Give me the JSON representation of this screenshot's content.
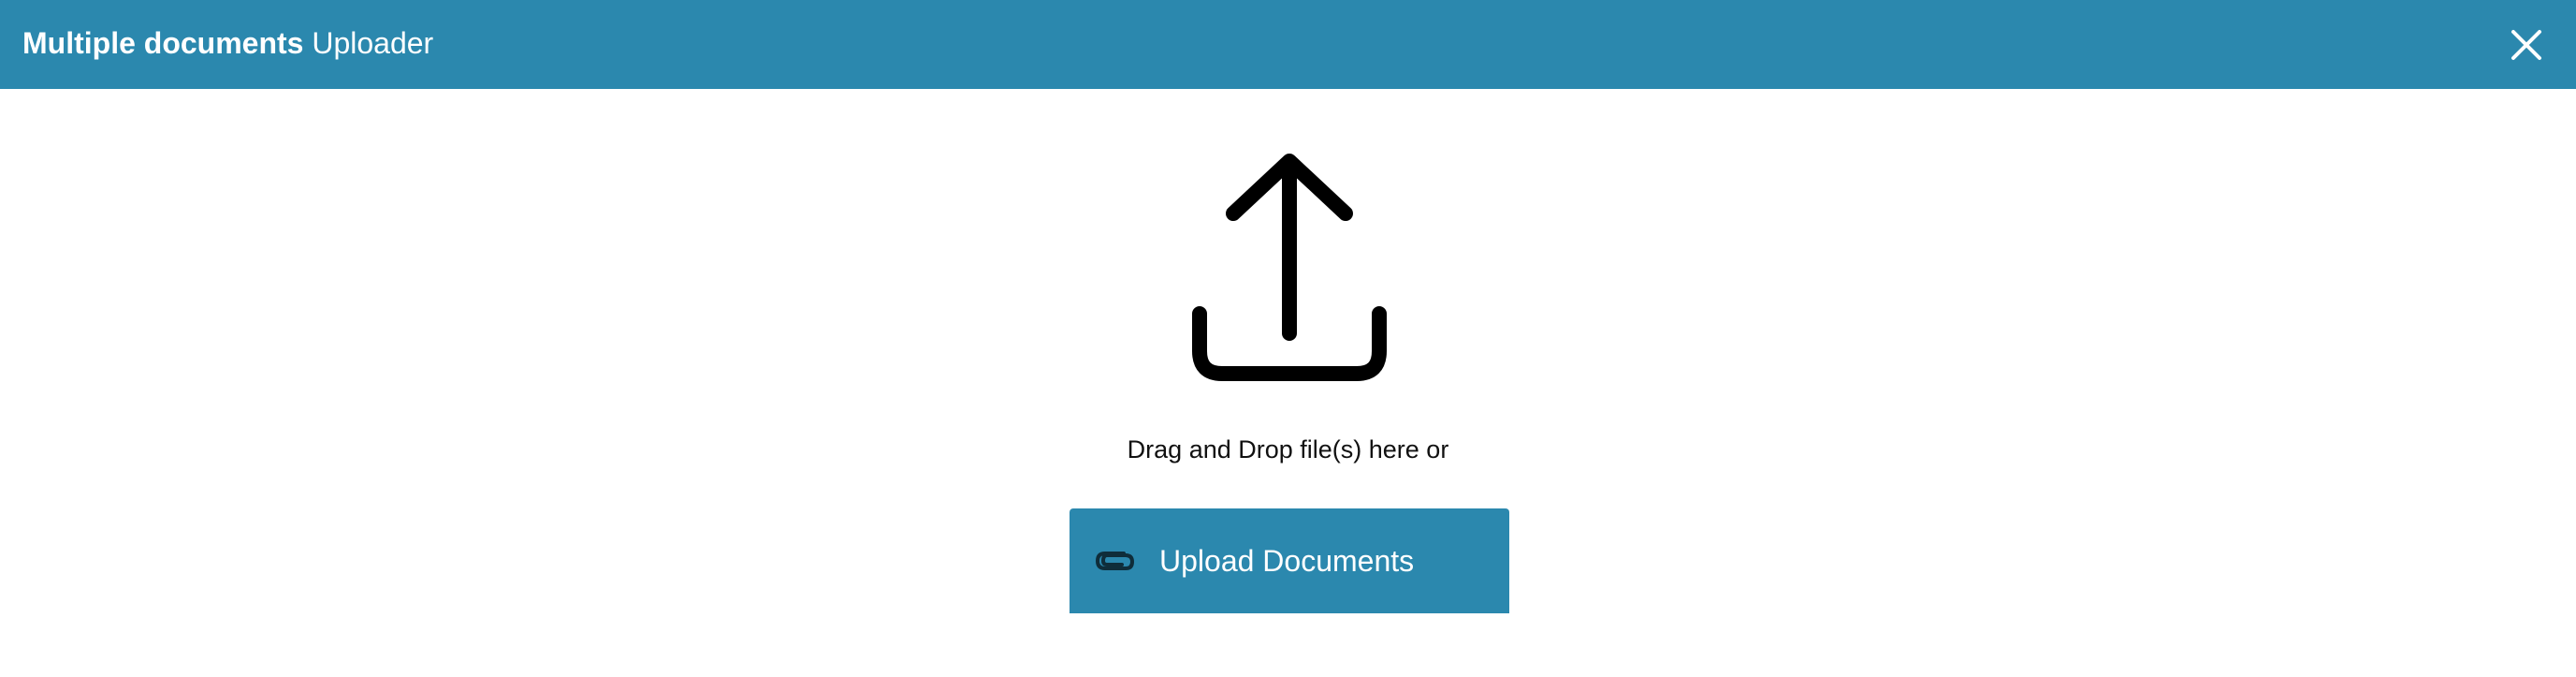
{
  "header": {
    "title_bold": "Multiple documents",
    "title_light": "Uploader",
    "close_icon": "close-icon",
    "background_color": "#2b88ae"
  },
  "dropzone": {
    "icon": "upload-icon",
    "instruction": "Drag and Drop file(s) here or"
  },
  "upload_button": {
    "icon": "paperclip-icon",
    "label": "Upload Documents",
    "background_color": "#2b88ae"
  }
}
